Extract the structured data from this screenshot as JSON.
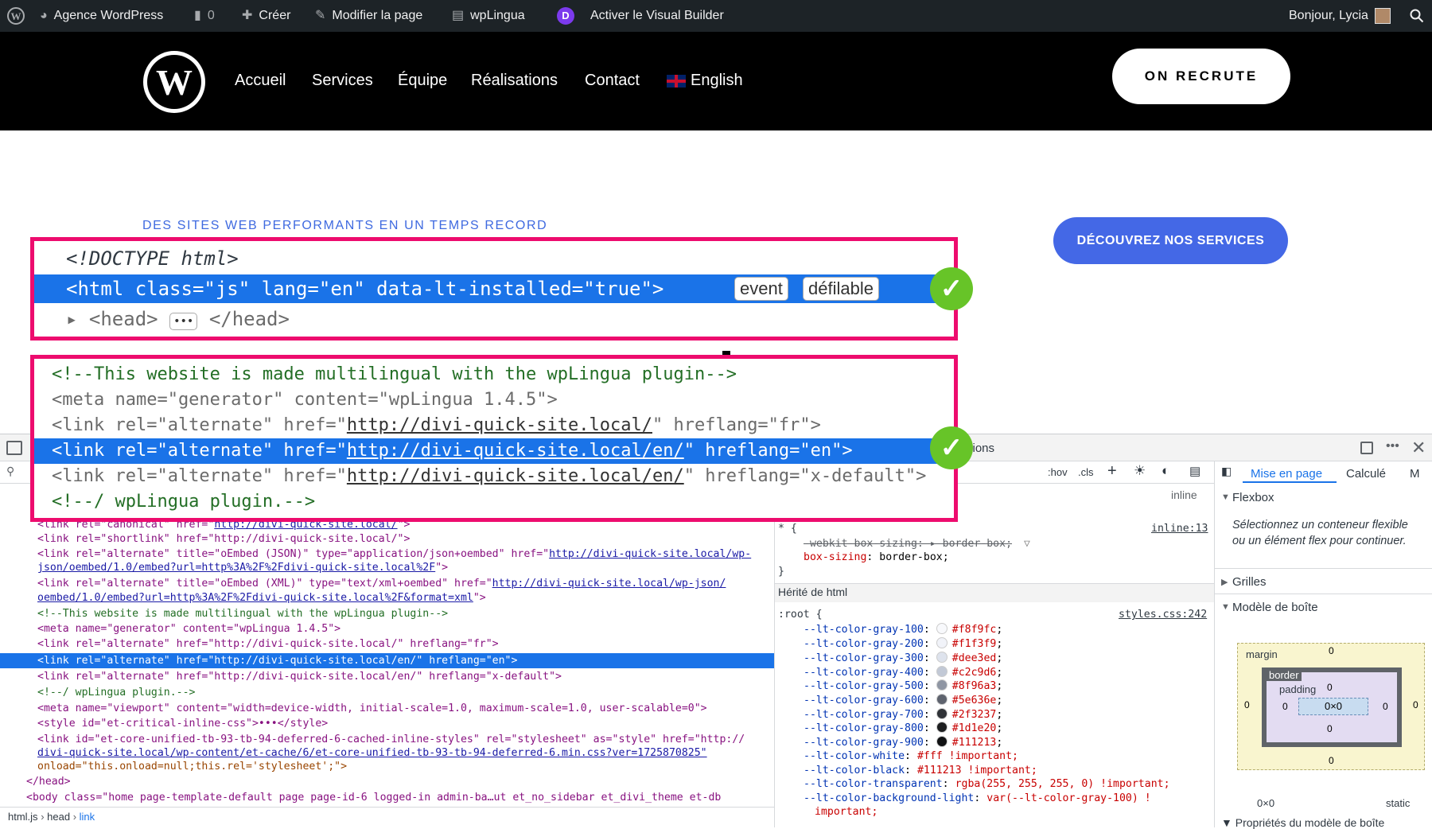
{
  "admin_bar": {
    "site_name": "Agence WordPress",
    "comments_count": "0",
    "new_label": "Créer",
    "edit_label": "Modifier la page",
    "translate_label": "wpLingua",
    "visual_builder_label": "Activer le Visual Builder",
    "greeting": "Bonjour, Lycia"
  },
  "header": {
    "nav": [
      "Accueil",
      "Services",
      "Équipe",
      "Réalisations",
      "Contact",
      "English"
    ],
    "cta": "ON RECRUTE"
  },
  "hero": {
    "tagline": "DES SITES WEB PERFORMANTS EN UN TEMPS RECORD",
    "button": "DÉCOUVREZ NOS SERVICES"
  },
  "callout1": {
    "line1": "<!DOCTYPE html>",
    "line2": "<html class=\"js\" lang=\"en\" data-lt-installed=\"true\">",
    "badge1": "event",
    "badge2": "défilable",
    "line3_open": "<head>",
    "line3_close": "</head>",
    "ellipsis": "•••"
  },
  "callout2": {
    "comment1": "<!--This website is made multilingual with the wpLingua plugin-->",
    "meta_line": "<meta name=\"generator\" content=\"wpLingua 1.4.5\">",
    "link_fr_pre": "<link rel=\"alternate\" href=\"",
    "link_fr_url": "http://divi-quick-site.local/",
    "link_fr_post": "\" hreflang=\"fr\">",
    "link_en_pre": "<link rel=\"alternate\" href=\"",
    "link_en_url": "http://divi-quick-site.local/en/",
    "link_en_post": "\" hreflang=\"en\">",
    "link_xd_pre": "<link rel=\"alternate\" href=\"",
    "link_xd_url": "http://divi-quick-site.local/en/",
    "link_xd_post": "\" hreflang=\"x-default\">",
    "comment2": "<!--/ wpLingua plugin.-->"
  },
  "devtools": {
    "elements_lines": [
      {
        "pre": "<link rel=\"canonical\" href=\"",
        "url": "http://divi-quick-site.local/",
        "post": "\">"
      },
      {
        "pre": "<link rel=\"shortlink\" href=\"http://divi-quick-site.local/\">",
        "url": "",
        "post": ""
      },
      {
        "pre": "<link rel=\"alternate\" title=\"oEmbed (JSON)\" type=\"application/json+oembed\" href=\"",
        "url": "http://divi-quick-site.local/wp-",
        "post": ""
      },
      {
        "pre": "",
        "url": "json/oembed/1.0/embed?url=http%3A%2F%2Fdivi-quick-site.local%2F",
        "post": "\">"
      },
      {
        "pre": "<link rel=\"alternate\" title=\"oEmbed (XML)\" type=\"text/xml+oembed\" href=\"",
        "url": "http://divi-quick-site.local/wp-json/",
        "post": ""
      },
      {
        "pre": "",
        "url": "oembed/1.0/embed?url=http%3A%2F%2Fdivi-quick-site.local%2F&format=xml",
        "post": "\">"
      },
      {
        "pre": "<!--This website is made multilingual with the wpLingua plugin-->",
        "url": "",
        "post": ""
      },
      {
        "pre": "<meta name=\"generator\" content=\"wpLingua 1.4.5\">",
        "url": "",
        "post": ""
      },
      {
        "pre": "<link rel=\"alternate\" href=\"http://divi-quick-site.local/\" hreflang=\"fr\">",
        "url": "",
        "post": ""
      }
    ],
    "selected_line": "<link rel=\"alternate\" href=\"http://divi-quick-site.local/en/\" hreflang=\"en\">",
    "elements_lines_after": [
      "<link rel=\"alternate\" href=\"http://divi-quick-site.local/en/\" hreflang=\"x-default\">",
      "<!--/ wpLingua plugin.-->",
      "<meta name=\"viewport\" content=\"width=device-width, initial-scale=1.0, maximum-scale=1.0, user-scalable=0\">",
      "<style id=\"et-critical-inline-css\">•••</style>",
      "<link id=\"et-core-unified-tb-93-tb-94-deferred-6-cached-inline-styles\" rel=\"stylesheet\" as=\"style\" href=\"http://",
      "divi-quick-site.local/wp-content/et-cache/6/et-core-unified-tb-93-tb-94-deferred-6.min.css?ver=1725870825\"",
      "onload=\"this.onload=null;this.rel='stylesheet';\">",
      "</head>",
      "<body class=\"home page-template-default page page-id-6 logged-in admin-ba…ut et_no_sidebar et_divi_theme et-db"
    ],
    "breadcrumb": [
      "html.js",
      "head",
      "link"
    ],
    "styles_tab_partial": "ations",
    "filter_controls": [
      ":hov",
      ".cls"
    ],
    "inline_label": "inline",
    "rule_source": "inline:13",
    "rule_selector": "* {",
    "rule_decl1": "-webkit-box-sizing: ▸ border-box;",
    "rule_decl2_prop": "box-sizing",
    "rule_decl2_val": "border-box;",
    "rule_close": "}",
    "inherited_label": "Hérité de html",
    "root_selector": ":root {",
    "root_source": "styles.css:242",
    "vars": [
      {
        "name": "--lt-color-gray-100",
        "value": "#f8f9fc",
        "color": "#f8f9fc"
      },
      {
        "name": "--lt-color-gray-200",
        "value": "#f1f3f9",
        "color": "#f1f3f9"
      },
      {
        "name": "--lt-color-gray-300",
        "value": "#dee3ed",
        "color": "#dee3ed"
      },
      {
        "name": "--lt-color-gray-400",
        "value": "#c2c9d6",
        "color": "#c2c9d6"
      },
      {
        "name": "--lt-color-gray-500",
        "value": "#8f96a3",
        "color": "#8f96a3"
      },
      {
        "name": "--lt-color-gray-600",
        "value": "#5e636e",
        "color": "#5e636e"
      },
      {
        "name": "--lt-color-gray-700",
        "value": "#2f3237",
        "color": "#2f3237"
      },
      {
        "name": "--lt-color-gray-800",
        "value": "#1d1e20",
        "color": "#1d1e20"
      },
      {
        "name": "--lt-color-gray-900",
        "value": "#111213",
        "color": "#111213"
      }
    ],
    "vars_plain": [
      {
        "name": "--lt-color-white",
        "value": "#fff !important;"
      },
      {
        "name": "--lt-color-black",
        "value": "#111213 !important;"
      },
      {
        "name": "--lt-color-transparent",
        "value": "rgba(255, 255, 255, 0) !important;"
      },
      {
        "name": "--lt-color-background-light",
        "value": "var(--lt-color-gray-100) !"
      }
    ],
    "important_wrap": "important;",
    "layout_tabs": [
      "Mise en page",
      "Calculé",
      "M"
    ],
    "flexbox_label": "Flexbox",
    "flexbox_hint": "Sélectionnez un conteneur flexible ou un élément flex pour continuer.",
    "grids_label": "Grilles",
    "boxmodel_label": "Modèle de boîte",
    "box": {
      "margin": "margin",
      "border": "border",
      "padding": "padding",
      "content": "0×0",
      "zero": "0"
    },
    "size_readout": "0×0",
    "position_readout": "static",
    "props_label": "Propriétés du modèle de boîte"
  },
  "colors": {
    "accent_pink": "#ed0c6e",
    "check_green": "#67c428",
    "selection_blue": "#1a73e8",
    "button_blue": "#4468e6"
  }
}
